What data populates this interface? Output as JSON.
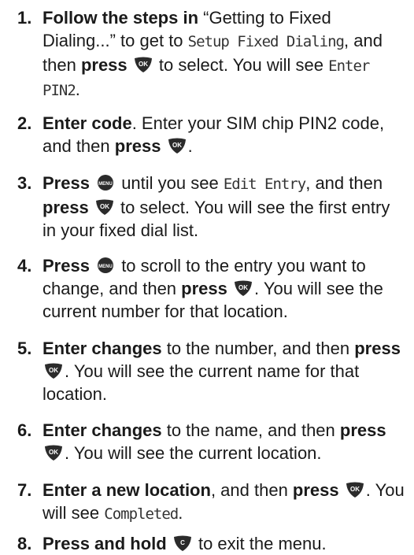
{
  "steps": [
    {
      "num": "1.",
      "parts": [
        {
          "t": "b",
          "v": "Follow the steps in"
        },
        {
          "t": "n",
          "v": " “Getting to Fixed Dialing...” to get to "
        },
        {
          "t": "lcd",
          "v": "Setup Fixed Dialing"
        },
        {
          "t": "n",
          "v": ", and then "
        },
        {
          "t": "b",
          "v": "press"
        },
        {
          "t": "n",
          "v": " "
        },
        {
          "t": "key",
          "v": "ok-key-icon"
        },
        {
          "t": "n",
          "v": " to select. You will see "
        },
        {
          "t": "lcd",
          "v": "Enter PIN2"
        },
        {
          "t": "n",
          "v": "."
        }
      ]
    },
    {
      "num": "2.",
      "parts": [
        {
          "t": "b",
          "v": "Enter code"
        },
        {
          "t": "n",
          "v": ". Enter your SIM chip PIN2 code, and then "
        },
        {
          "t": "b",
          "v": "press"
        },
        {
          "t": "n",
          "v": " "
        },
        {
          "t": "key",
          "v": "ok-key-icon"
        },
        {
          "t": "n",
          "v": "."
        }
      ]
    },
    {
      "num": "3.",
      "parts": [
        {
          "t": "b",
          "v": "Press"
        },
        {
          "t": "n",
          "v": " "
        },
        {
          "t": "key",
          "v": "menu-key-icon"
        },
        {
          "t": "n",
          "v": " until you see "
        },
        {
          "t": "lcd",
          "v": "Edit Entry"
        },
        {
          "t": "n",
          "v": ", and then "
        },
        {
          "t": "b",
          "v": "press"
        },
        {
          "t": "n",
          "v": " "
        },
        {
          "t": "key",
          "v": "ok-key-icon"
        },
        {
          "t": "n",
          "v": " to select. You will see the first entry in your fixed dial list."
        }
      ]
    },
    {
      "num": "4.",
      "parts": [
        {
          "t": "b",
          "v": "Press"
        },
        {
          "t": "n",
          "v": " "
        },
        {
          "t": "key",
          "v": "menu-key-icon"
        },
        {
          "t": "n",
          "v": " to scroll to the entry you want to change, and then "
        },
        {
          "t": "b",
          "v": "press"
        },
        {
          "t": "n",
          "v": " "
        },
        {
          "t": "key",
          "v": "ok-key-icon"
        },
        {
          "t": "n",
          "v": ". You will see the current number for that location."
        }
      ]
    },
    {
      "num": "5.",
      "parts": [
        {
          "t": "b",
          "v": "Enter changes"
        },
        {
          "t": "n",
          "v": " to the number, and then "
        },
        {
          "t": "b",
          "v": "press"
        },
        {
          "t": "n",
          "v": " "
        },
        {
          "t": "key",
          "v": "ok-key-icon"
        },
        {
          "t": "n",
          "v": ". You will see the current name for that location."
        }
      ]
    },
    {
      "num": "6.",
      "parts": [
        {
          "t": "b",
          "v": "Enter changes"
        },
        {
          "t": "n",
          "v": " to the name, and then "
        },
        {
          "t": "b",
          "v": "press"
        },
        {
          "t": "n",
          "v": " "
        },
        {
          "t": "key",
          "v": "ok-key-icon"
        },
        {
          "t": "n",
          "v": ". You will see the current location."
        }
      ]
    },
    {
      "num": "7.",
      "parts": [
        {
          "t": "b",
          "v": "Enter a new location"
        },
        {
          "t": "n",
          "v": ", and then "
        },
        {
          "t": "b",
          "v": "press"
        },
        {
          "t": "n",
          "v": " "
        },
        {
          "t": "key",
          "v": "ok-key-icon"
        },
        {
          "t": "n",
          "v": ". You will see "
        },
        {
          "t": "lcd",
          "v": "Completed"
        },
        {
          "t": "n",
          "v": "."
        }
      ]
    },
    {
      "num": "8.",
      "parts": [
        {
          "t": "b",
          "v": "Press and hold"
        },
        {
          "t": "n",
          "v": " "
        },
        {
          "t": "key",
          "v": "clear-key-icon"
        },
        {
          "t": "n",
          "v": " to exit the menu."
        }
      ]
    }
  ],
  "keys": {
    "ok-key-icon": {
      "label": "OK",
      "color": "#2b2b2b"
    },
    "menu-key-icon": {
      "label": "MENU",
      "color": "#2b2b2b"
    },
    "clear-key-icon": {
      "label": "C",
      "color": "#2b2b2b"
    }
  }
}
